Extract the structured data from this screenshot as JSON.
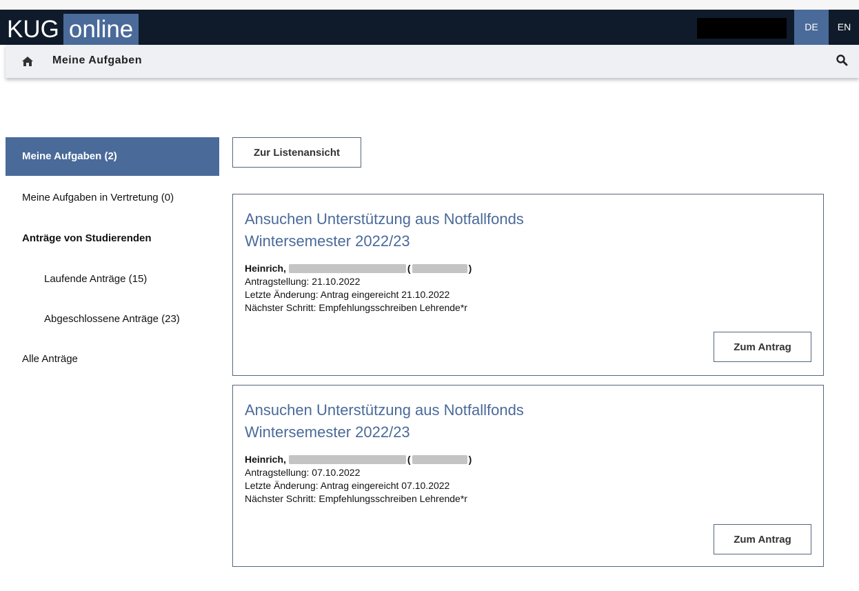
{
  "header": {
    "logo_left": "KUG",
    "logo_right": "online",
    "languages": [
      "DE",
      "EN"
    ]
  },
  "breadcrumb": {
    "title": "Meine Aufgaben"
  },
  "sidebar": {
    "items": [
      {
        "label": "Meine Aufgaben (2)"
      },
      {
        "label": "Meine Aufgaben in Vertretung (0)"
      },
      {
        "label": "Anträge von Studierenden"
      },
      {
        "label": "Laufende Anträge (15)"
      },
      {
        "label": "Abgeschlossene Anträge (23)"
      },
      {
        "label": "Alle Anträge"
      }
    ]
  },
  "main": {
    "list_view_button": "Zur Listenansicht",
    "cards": [
      {
        "title_line1": "Ansuchen Unterstützung aus Notfallfonds",
        "title_line2": "Wintersemester 2022/23",
        "name": "Heinrich,",
        "name_paren_open": "(",
        "name_paren_close": ")",
        "submitted": "Antragstellung: 21.10.2022",
        "last_change": "Letzte Änderung: Antrag eingereicht 21.10.2022",
        "next_step": "Nächster Schritt: Empfehlungsschreiben Lehrende*r",
        "button": "Zum Antrag"
      },
      {
        "title_line1": "Ansuchen Unterstützung aus Notfallfonds",
        "title_line2": "Wintersemester 2022/23",
        "name": "Heinrich,",
        "name_paren_open": "(",
        "name_paren_close": ")",
        "submitted": "Antragstellung: 07.10.2022",
        "last_change": "Letzte Änderung: Antrag eingereicht 07.10.2022",
        "next_step": "Nächster Schritt: Empfehlungsschreiben Lehrende*r",
        "button": "Zum Antrag"
      }
    ]
  },
  "colors": {
    "header_dark": "#0f1b2a",
    "accent": "#4a6a99",
    "breadcrumb_bg": "#eef0f4"
  }
}
